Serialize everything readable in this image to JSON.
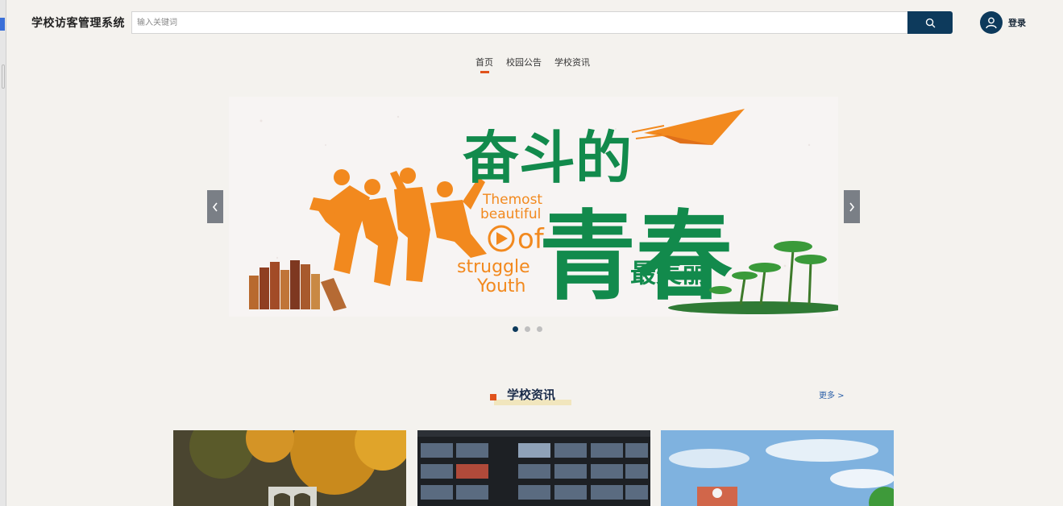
{
  "header": {
    "site_title": "学校访客管理系统",
    "search_placeholder": "输入关键词",
    "login_label": "登录"
  },
  "nav": {
    "items": [
      {
        "label": "首页",
        "active": true
      },
      {
        "label": "校园公告",
        "active": false
      },
      {
        "label": "学校资讯",
        "active": false
      }
    ]
  },
  "banner": {
    "headline_1": "奋斗的",
    "headline_2": "青春",
    "headline_3": "最美丽",
    "english_lines": [
      "Themost",
      "beautiful",
      "of",
      "struggle",
      "Youth"
    ],
    "active_slide": 1,
    "slide_count": 3
  },
  "section": {
    "title": "学校资讯",
    "more_label": "更多 >"
  },
  "colors": {
    "primary": "#0d3a5c",
    "accent": "#e0531c",
    "banner_green": "#128a4c",
    "banner_orange": "#f2891e"
  },
  "icons": {
    "search": "search-icon",
    "user": "user-icon",
    "prev": "chevron-left-icon",
    "next": "chevron-right-icon"
  }
}
